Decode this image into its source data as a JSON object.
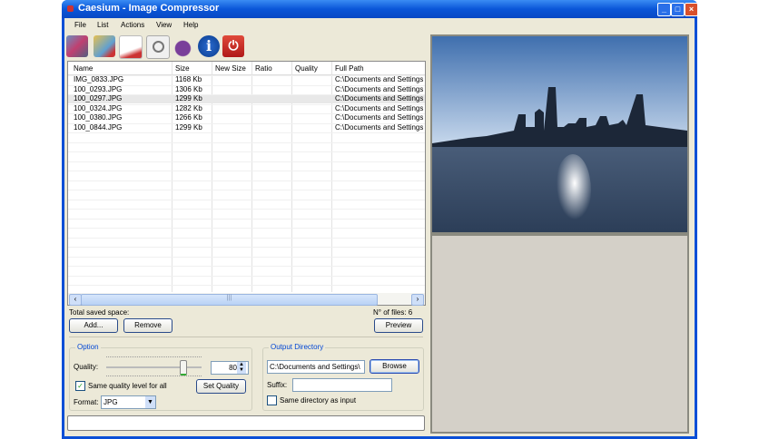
{
  "window": {
    "title": "Caesium - Image Compressor",
    "controls": [
      "minimize",
      "maximize",
      "close"
    ]
  },
  "menu": [
    "File",
    "List",
    "Actions",
    "View",
    "Help"
  ],
  "toolbar": [
    {
      "icon": "add-images-icon"
    },
    {
      "icon": "remove-image-icon"
    },
    {
      "icon": "clear-list-icon"
    },
    {
      "icon": "preview-icon"
    },
    {
      "icon": "compress-icon"
    },
    {
      "icon": "info-icon"
    },
    {
      "icon": "exit-icon"
    }
  ],
  "list": {
    "columns": [
      "Name",
      "Size",
      "New Size",
      "Ratio",
      "Quality",
      "Full Path"
    ],
    "rows": [
      [
        "IMG_0833.JPG",
        "1168 Kb",
        "",
        "",
        "",
        "C:\\Documents and Settings"
      ],
      [
        "100_0293.JPG",
        "1306 Kb",
        "",
        "",
        "",
        "C:\\Documents and Settings"
      ],
      [
        "100_0297.JPG",
        "1299 Kb",
        "",
        "",
        "",
        "C:\\Documents and Settings"
      ],
      [
        "100_0324.JPG",
        "1282 Kb",
        "",
        "",
        "",
        "C:\\Documents and Settings"
      ],
      [
        "100_0380.JPG",
        "1266 Kb",
        "",
        "",
        "",
        "C:\\Documents and Settings"
      ],
      [
        "100_0844.JPG",
        "1299 Kb",
        "",
        "",
        "",
        "C:\\Documents and Settings"
      ]
    ],
    "selected_row": 2
  },
  "summary": {
    "saved_space": "Total saved space:",
    "file_count": "N° of files: 6"
  },
  "buttons": {
    "add": "Add...",
    "remove": "Remove",
    "preview": "Preview",
    "set_quality": "Set Quality",
    "browse": "Browse"
  },
  "option": {
    "legend": "Option",
    "quality_label": "Quality:",
    "quality_value": "80",
    "quality_slider_percent": 80,
    "same_quality_label": "Same quality level for all",
    "same_quality_checked": true,
    "format_label": "Format:",
    "format_value": "JPG"
  },
  "output": {
    "legend": "Output Directory",
    "directory": "C:\\Documents and Settings\\",
    "suffix_label": "Suffix:",
    "suffix_value": "",
    "same_dir_label": "Same directory as input",
    "same_dir_checked": false
  }
}
